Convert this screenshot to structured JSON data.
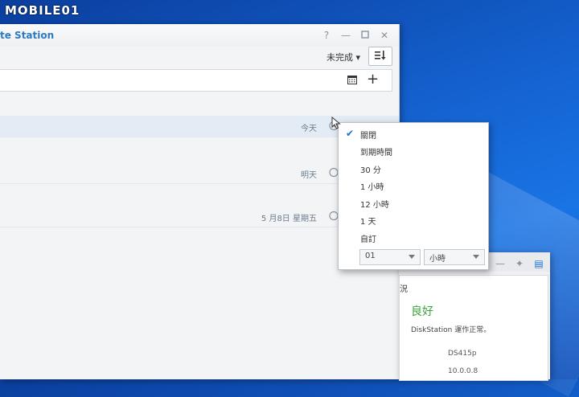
{
  "watermark": "MOBILE01",
  "app": {
    "title": "te Station",
    "filter_label": "未完成 ▾"
  },
  "tasks": [
    {
      "due": "今天"
    },
    {
      "due": "明天"
    },
    {
      "due": "5 月8日 星期五"
    }
  ],
  "reminder_menu": {
    "items": [
      {
        "label": "關閉",
        "checked": true
      },
      {
        "label": "到期時間",
        "checked": false
      },
      {
        "label": "30 分",
        "checked": false
      },
      {
        "label": "1 小時",
        "checked": false
      },
      {
        "label": "12 小時",
        "checked": false
      },
      {
        "label": "1 天",
        "checked": false
      },
      {
        "label": "自訂",
        "checked": false
      }
    ],
    "custom_value": "01",
    "custom_unit": "小時"
  },
  "status_widget": {
    "heading": "況",
    "status": "良好",
    "message": "DiskStation 運作正常。",
    "model": "DS415p",
    "ip": "10.0.0.8"
  },
  "colors": {
    "accent": "#1f6fd0",
    "status_good": "#3aa53a",
    "title": "#2c7ac0"
  }
}
